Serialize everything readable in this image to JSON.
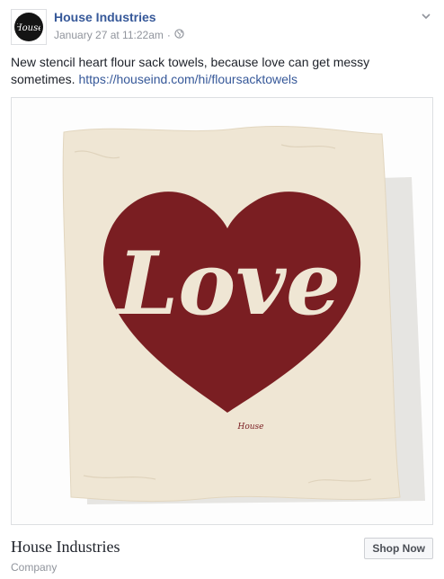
{
  "post": {
    "page_name": "House Industries",
    "timestamp": "January 27 at 11:22am",
    "separator": "·",
    "privacy_icon": "globe-icon",
    "avatar_text": "House",
    "text": "New stencil heart flour sack towels, because love can get messy sometimes.",
    "link": "https://houseind.com/hi/floursacktowels"
  },
  "image": {
    "lettering": "Love",
    "signature": "House",
    "towel_color": "#efe6d4",
    "heart_color": "#7a1e22"
  },
  "footer": {
    "title": "House Industries",
    "subtitle": "Company",
    "cta_label": "Shop Now"
  }
}
